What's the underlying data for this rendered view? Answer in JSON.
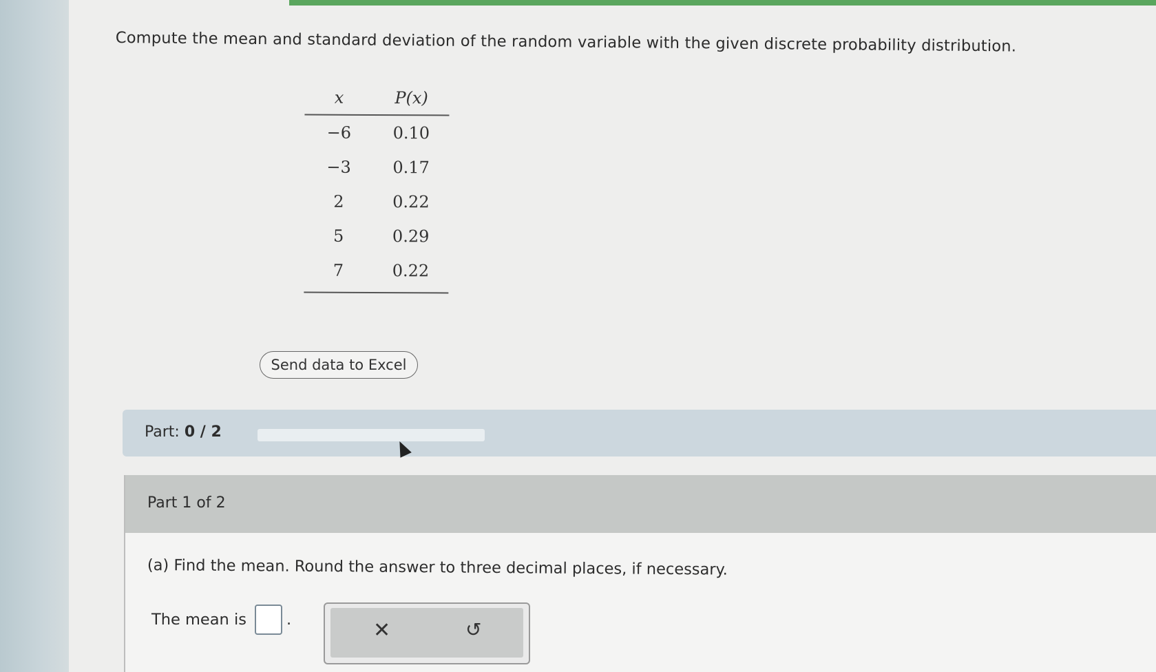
{
  "question": {
    "text": "Compute the mean and standard deviation of the random variable with the given discrete probability distribution."
  },
  "table": {
    "header": {
      "x": "x",
      "px": "P(x)"
    },
    "rows": [
      {
        "x": "−6",
        "px": "0.10"
      },
      {
        "x": "−3",
        "px": "0.17"
      },
      {
        "x": "2",
        "px": "0.22"
      },
      {
        "x": "5",
        "px": "0.29"
      },
      {
        "x": "7",
        "px": "0.22"
      }
    ]
  },
  "excel_button": {
    "label": "Send data to Excel"
  },
  "part_progress": {
    "label": "Part:",
    "value": "0 / 2",
    "fraction": 0
  },
  "part_card": {
    "header": "Part 1 of 2",
    "question_a": "(a) Find the mean. Round the answer to three decimal places, if necessary.",
    "mean_label": "The mean is",
    "answer_value": "",
    "trailing": "."
  },
  "tools": {
    "clear_icon": "close-icon",
    "undo_icon": "undo-icon"
  },
  "colors": {
    "top_bar": "#5aa65e",
    "part_bar": "#ccd7de",
    "part_card_header": "#c5c8c6"
  }
}
